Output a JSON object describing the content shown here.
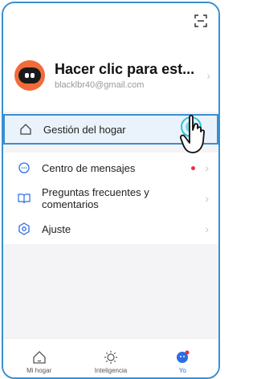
{
  "profile": {
    "name": "Hacer clic para est...",
    "email": "blacklbr40@gmail.com"
  },
  "menu": {
    "home": "Gestión del hogar",
    "messages": "Centro de mensajes",
    "faq": "Preguntas frecuentes y comentarios",
    "settings": "Ajuste"
  },
  "tabs": {
    "home": "Mi hogar",
    "smart": "Inteligencia",
    "me": "Yo"
  },
  "colors": {
    "accent": "#2b6de3",
    "highlight_border": "#3a8fd0",
    "avatar": "#f26b3a",
    "notification_dot": "#e5333b"
  },
  "icons": [
    "scan-icon",
    "home-icon",
    "message-icon",
    "book-icon",
    "settings-icon",
    "house-tab-icon",
    "sun-icon",
    "user-icon",
    "hand-pointer-icon"
  ]
}
